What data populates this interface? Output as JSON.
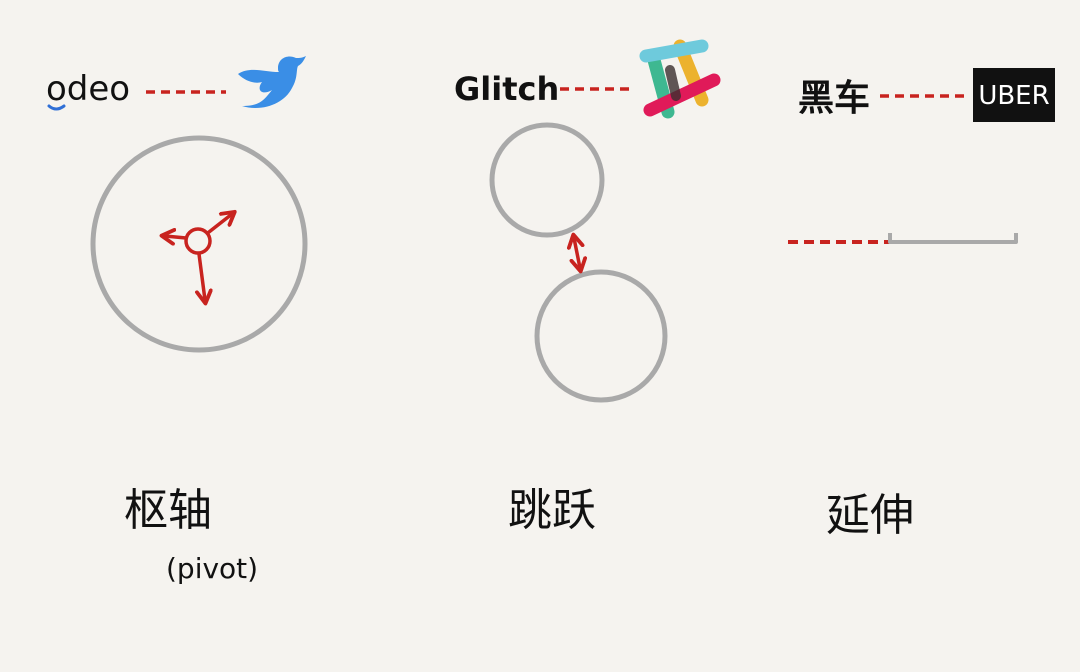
{
  "pivot": {
    "from_brand": "odeo",
    "to_brand_icon": "twitter-bird-icon",
    "caption": "枢轴",
    "caption_sub": "(pivot)"
  },
  "jump": {
    "from_brand": "Glitch",
    "to_brand_icon": "slack-logo-icon",
    "caption": "跳跃"
  },
  "extend": {
    "from_brand": "黑车",
    "to_brand": "UBER",
    "caption": "延伸"
  },
  "colors": {
    "background": "#f5f3ef",
    "accent_red": "#c8231f",
    "circle_gray": "#a9a9a9",
    "ink": "#111111",
    "twitter_blue": "#3a8ee6",
    "odeo_blue": "#2f6fd6",
    "uber_black": "#111111"
  }
}
